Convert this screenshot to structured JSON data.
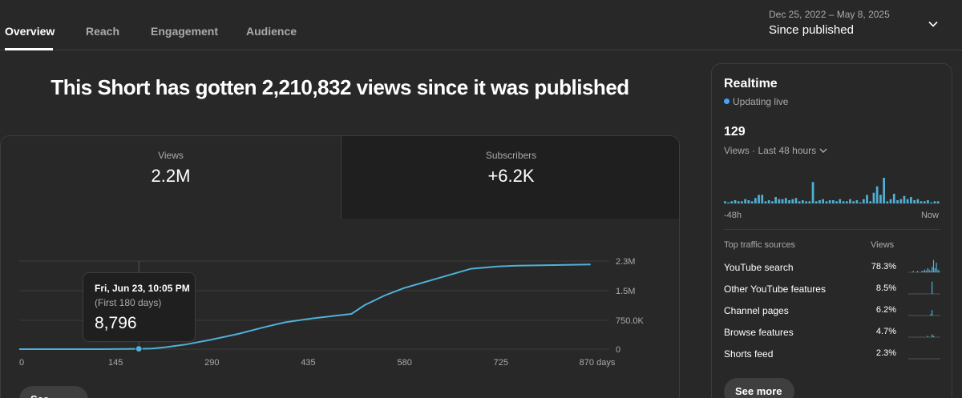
{
  "tabs": [
    {
      "label": "Overview",
      "active": true
    },
    {
      "label": "Reach",
      "active": false
    },
    {
      "label": "Engagement",
      "active": false
    },
    {
      "label": "Audience",
      "active": false
    }
  ],
  "date_range": {
    "dates": "Dec 25, 2022 – May 8, 2025",
    "label": "Since published"
  },
  "headline": "This Short has gotten 2,210,832 views since it was published",
  "metrics": {
    "views": {
      "label": "Views",
      "value": "2.2M"
    },
    "subscribers": {
      "label": "Subscribers",
      "value": "+6.2K"
    }
  },
  "tooltip": {
    "date": "Fri, Jun 23, 10:05 PM",
    "subtitle": "(First 180 days)",
    "value": "8,796"
  },
  "see_more_label": "See more",
  "chart_data": {
    "type": "line",
    "x_ticks": [
      "0",
      "145",
      "290",
      "435",
      "580",
      "725",
      "870 days"
    ],
    "y_ticks": [
      "0",
      "750.0K",
      "1.5M",
      "2.3M"
    ],
    "ylim": [
      0,
      2300000
    ],
    "xlim": [
      0,
      870
    ],
    "grid": true,
    "x": [
      0,
      120,
      180,
      200,
      220,
      250,
      290,
      330,
      370,
      400,
      440,
      480,
      500,
      520,
      550,
      580,
      620,
      680,
      720,
      750,
      860
    ],
    "values": [
      0,
      0,
      8796,
      15000,
      50000,
      120000,
      250000,
      400000,
      580000,
      700000,
      800000,
      880000,
      920000,
      1150000,
      1400000,
      1600000,
      1800000,
      2100000,
      2160000,
      2180000,
      2210832
    ],
    "highlight_x": 180,
    "accent_color": "#4fb1d6"
  },
  "realtime": {
    "title": "Realtime",
    "status": "Updating live",
    "count": "129",
    "period": "Views · Last 48 hours",
    "axis_start": "-48h",
    "axis_end": "Now",
    "bars": [
      2,
      1,
      2,
      3,
      2,
      2,
      4,
      3,
      2,
      5,
      8,
      8,
      2,
      3,
      2,
      6,
      4,
      4,
      5,
      3,
      4,
      5,
      2,
      3,
      2,
      2,
      20,
      2,
      3,
      4,
      2,
      3,
      3,
      2,
      4,
      2,
      2,
      4,
      2,
      3,
      1,
      4,
      8,
      2,
      10,
      16,
      8,
      24,
      2,
      4,
      9,
      3,
      4,
      7,
      4,
      6,
      3,
      4,
      2,
      2,
      3,
      1,
      2,
      2
    ]
  },
  "traffic": {
    "header_source": "Top traffic sources",
    "header_views": "Views",
    "rows": [
      {
        "name": "YouTube search",
        "pct": "78.3%",
        "spark": [
          0,
          0,
          0,
          1,
          0,
          0,
          1,
          0,
          0,
          1,
          1,
          2,
          1,
          3,
          2,
          1,
          4,
          9,
          3,
          7,
          2,
          1
        ]
      },
      {
        "name": "Other YouTube features",
        "pct": "8.5%",
        "spark": [
          0,
          0,
          0,
          0,
          0,
          0,
          0,
          0,
          0,
          0,
          0,
          0,
          0,
          0,
          0,
          0,
          9,
          0,
          0,
          0,
          0,
          0
        ]
      },
      {
        "name": "Channel pages",
        "pct": "6.2%",
        "spark": [
          0,
          0,
          0,
          0,
          0,
          0,
          0,
          0,
          0,
          0,
          0,
          0,
          0,
          0,
          0,
          1,
          4,
          0,
          0,
          0,
          0,
          0
        ]
      },
      {
        "name": "Browse features",
        "pct": "4.7%",
        "spark": [
          0,
          0,
          0,
          0,
          0,
          0,
          0,
          0,
          0,
          0,
          0,
          0,
          0,
          1,
          0,
          0,
          2,
          1,
          0,
          0,
          0,
          0
        ]
      },
      {
        "name": "Shorts feed",
        "pct": "2.3%",
        "spark": [
          0,
          0,
          0,
          0,
          0,
          0,
          0,
          0,
          0,
          0,
          0,
          0,
          0,
          0,
          0,
          0,
          0,
          0,
          0,
          0,
          0,
          0
        ]
      }
    ],
    "see_more_label": "See more"
  }
}
